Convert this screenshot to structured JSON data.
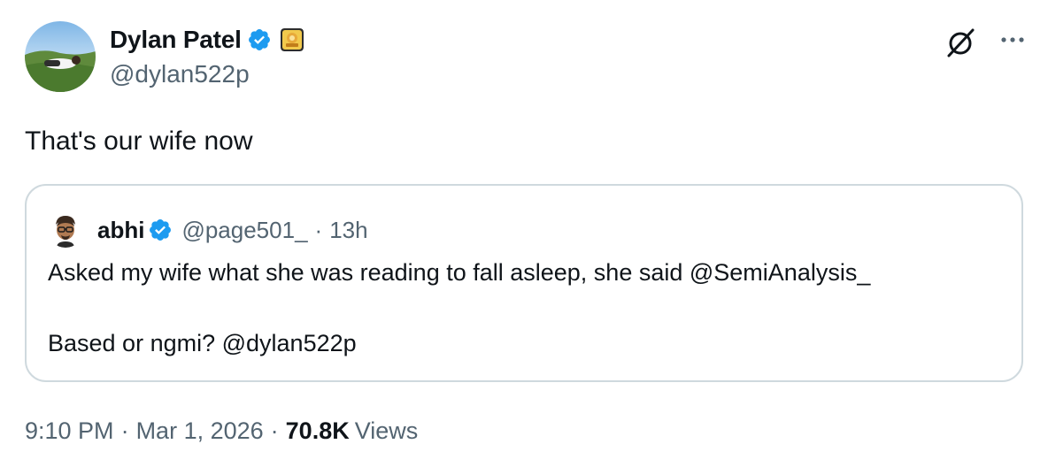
{
  "author": {
    "display_name": "Dylan Patel",
    "handle": "@dylan522p",
    "avatar_icon": "profile-photo",
    "verified_icon": "verified-badge-icon",
    "affiliate_icon": "affiliate-badge-icon"
  },
  "header_actions": {
    "grok_icon": "grok-icon",
    "more_icon": "more-options-icon"
  },
  "tweet": {
    "text": "That's our wife now"
  },
  "quoted_tweet": {
    "display_name": "abhi",
    "handle": "@page501_",
    "separator": "·",
    "time": "13h",
    "line1": "Asked my wife what she was reading to fall asleep, she said @SemiAnalysis_",
    "line2": "Based or ngmi? @dylan522p"
  },
  "meta": {
    "time": "9:10 PM",
    "separator": "·",
    "date": "Mar 1, 2026",
    "views_count": "70.8K",
    "views_label": "Views"
  },
  "colors": {
    "text_primary": "#0f1419",
    "text_secondary": "#536471",
    "verified_blue": "#1d9bf0",
    "border": "#cfd9de"
  }
}
